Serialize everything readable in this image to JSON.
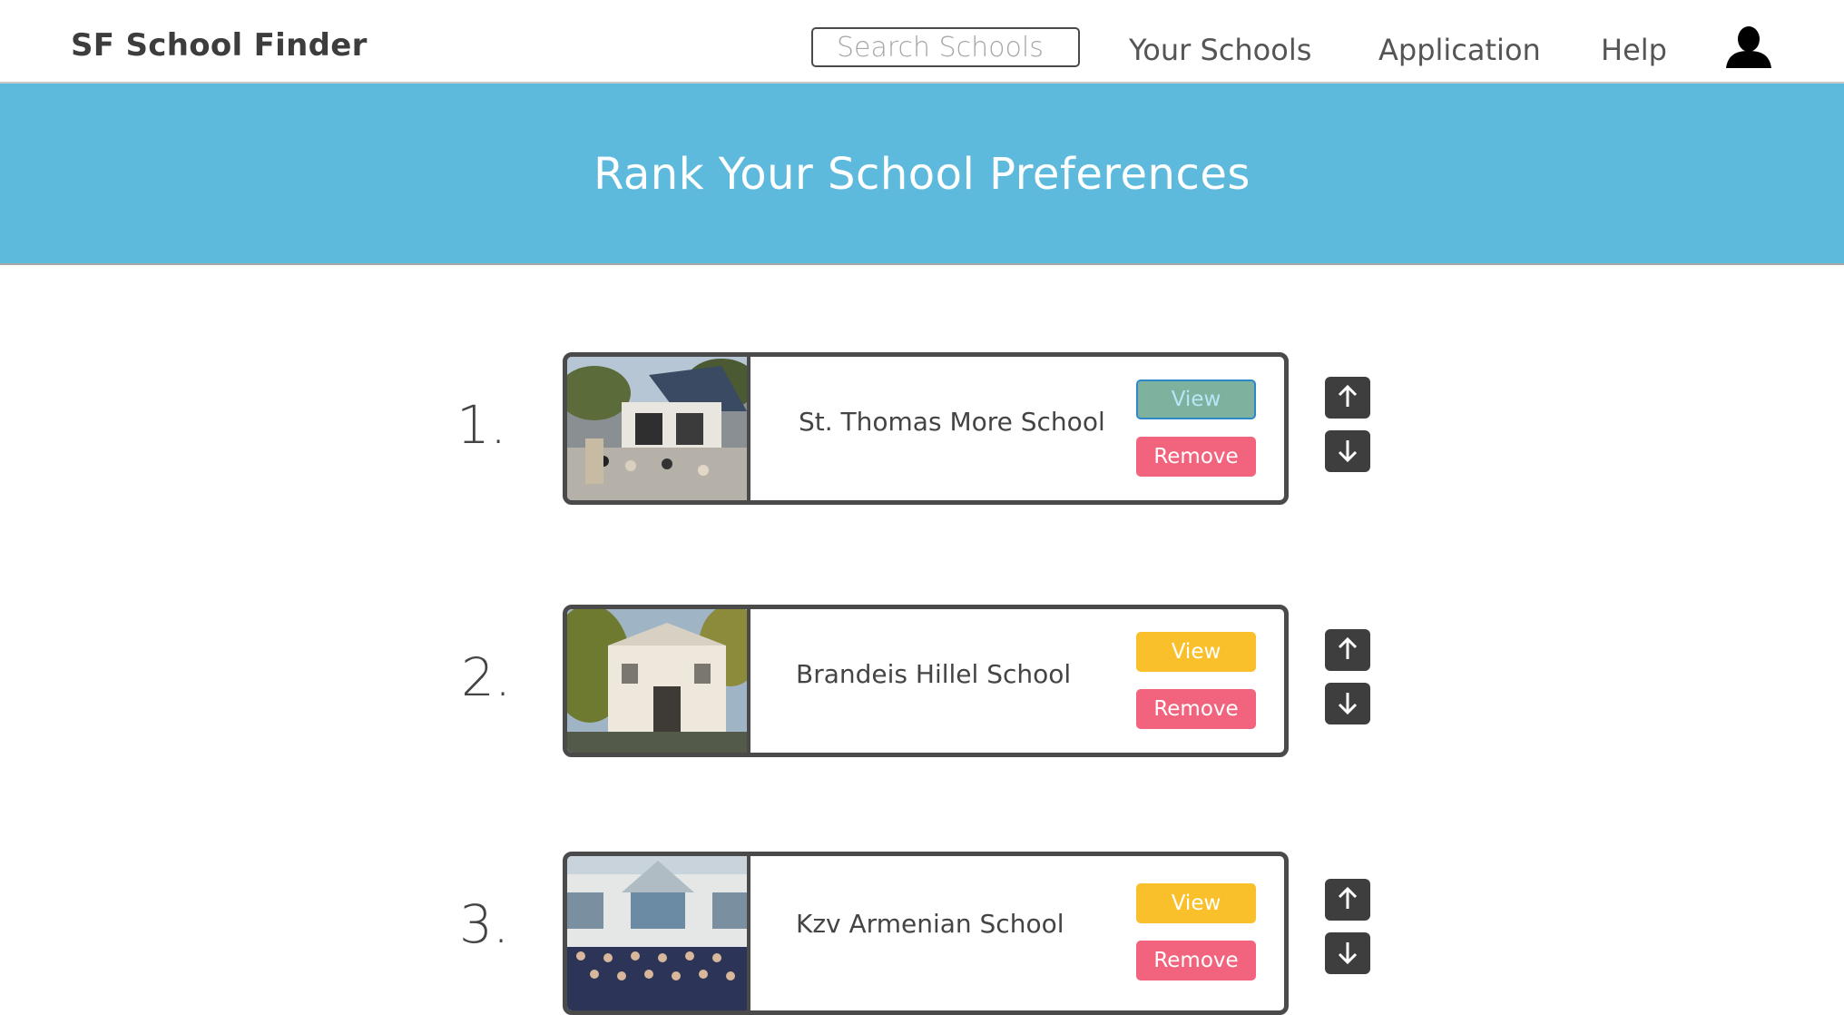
{
  "nav": {
    "brand": "SF School Finder",
    "search_placeholder": "Search Schools",
    "links": [
      "Your Schools",
      "Application",
      "Help"
    ],
    "profile_icon": "user-icon"
  },
  "banner": {
    "title": "Rank Your School Preferences",
    "color": "#5ebadc"
  },
  "colors": {
    "view_button": "#f9c02c",
    "remove_button": "#f2647e",
    "arrow_button": "#3e3e3e"
  },
  "schools": [
    {
      "rank": "1.",
      "name": "St. Thomas More School",
      "view_label": "View",
      "remove_label": "Remove",
      "view_state": "pressed"
    },
    {
      "rank": "2.",
      "name": "Brandeis Hillel School",
      "view_label": "View",
      "remove_label": "Remove",
      "view_state": "normal"
    },
    {
      "rank": "3.",
      "name": "Kzv Armenian School",
      "view_label": "View",
      "remove_label": "Remove",
      "view_state": "normal"
    }
  ]
}
